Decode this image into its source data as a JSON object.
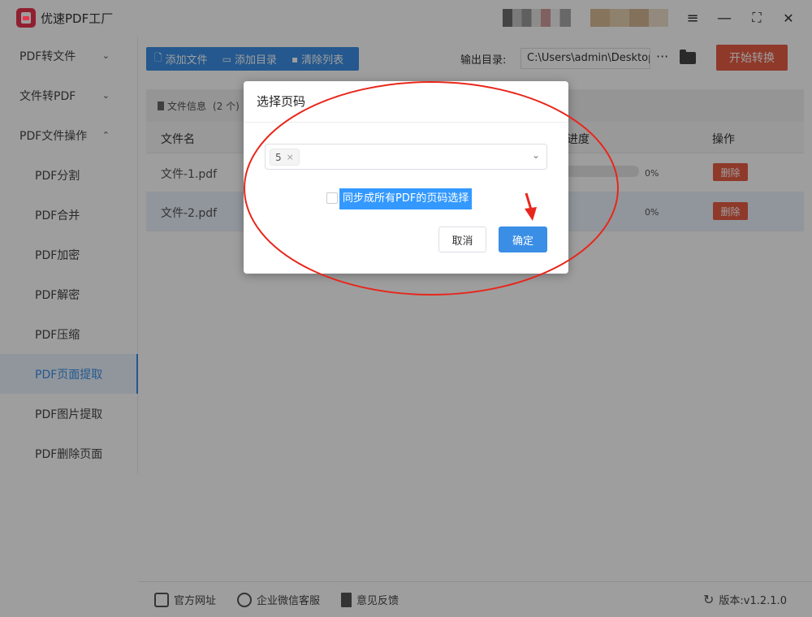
{
  "app": {
    "title": "优速PDF工厂"
  },
  "window_controls": {
    "menu": "≡",
    "minimize": "—",
    "maximize": "⛶",
    "close": "✕"
  },
  "sidebar": {
    "items": [
      {
        "label": "PDF转文件",
        "chevron": "⌄"
      },
      {
        "label": "文件转PDF",
        "chevron": "⌄"
      },
      {
        "label": "PDF文件操作",
        "chevron": "⌃"
      },
      {
        "label": "PDF分割"
      },
      {
        "label": "PDF合并"
      },
      {
        "label": "PDF加密"
      },
      {
        "label": "PDF解密"
      },
      {
        "label": "PDF压缩"
      },
      {
        "label": "PDF页面提取",
        "active": true
      },
      {
        "label": "PDF图片提取"
      },
      {
        "label": "PDF删除页面"
      }
    ]
  },
  "toolbar": {
    "add_file": "添加文件",
    "add_dir": "添加目录",
    "clear_list": "清除列表",
    "output_label": "输出目录:",
    "output_path": "C:\\Users\\admin\\Desktop",
    "more": "···",
    "start": "开始转换"
  },
  "file_info": {
    "label": "文件信息",
    "count": "(2 个)"
  },
  "table": {
    "headers": {
      "name": "文件名",
      "progress": "进度",
      "action": "操作"
    },
    "rows": [
      {
        "name": "文件-1.pdf",
        "progress": "0%",
        "action": "删除"
      },
      {
        "name": "文件-2.pdf",
        "progress": "0%",
        "action": "删除"
      }
    ]
  },
  "footer": {
    "website": "官方网址",
    "wechat": "企业微信客服",
    "feedback": "意见反馈",
    "version": "版本:v1.2.1.0"
  },
  "dialog": {
    "title": "选择页码",
    "selected_tag": "5",
    "tag_close": "×",
    "sync_label": "同步成所有PDF的页码选择",
    "cancel": "取消",
    "confirm": "确定"
  },
  "colors": {
    "accent": "#3a8ee6",
    "danger": "#e75c45",
    "annotation": "#e8261b"
  }
}
